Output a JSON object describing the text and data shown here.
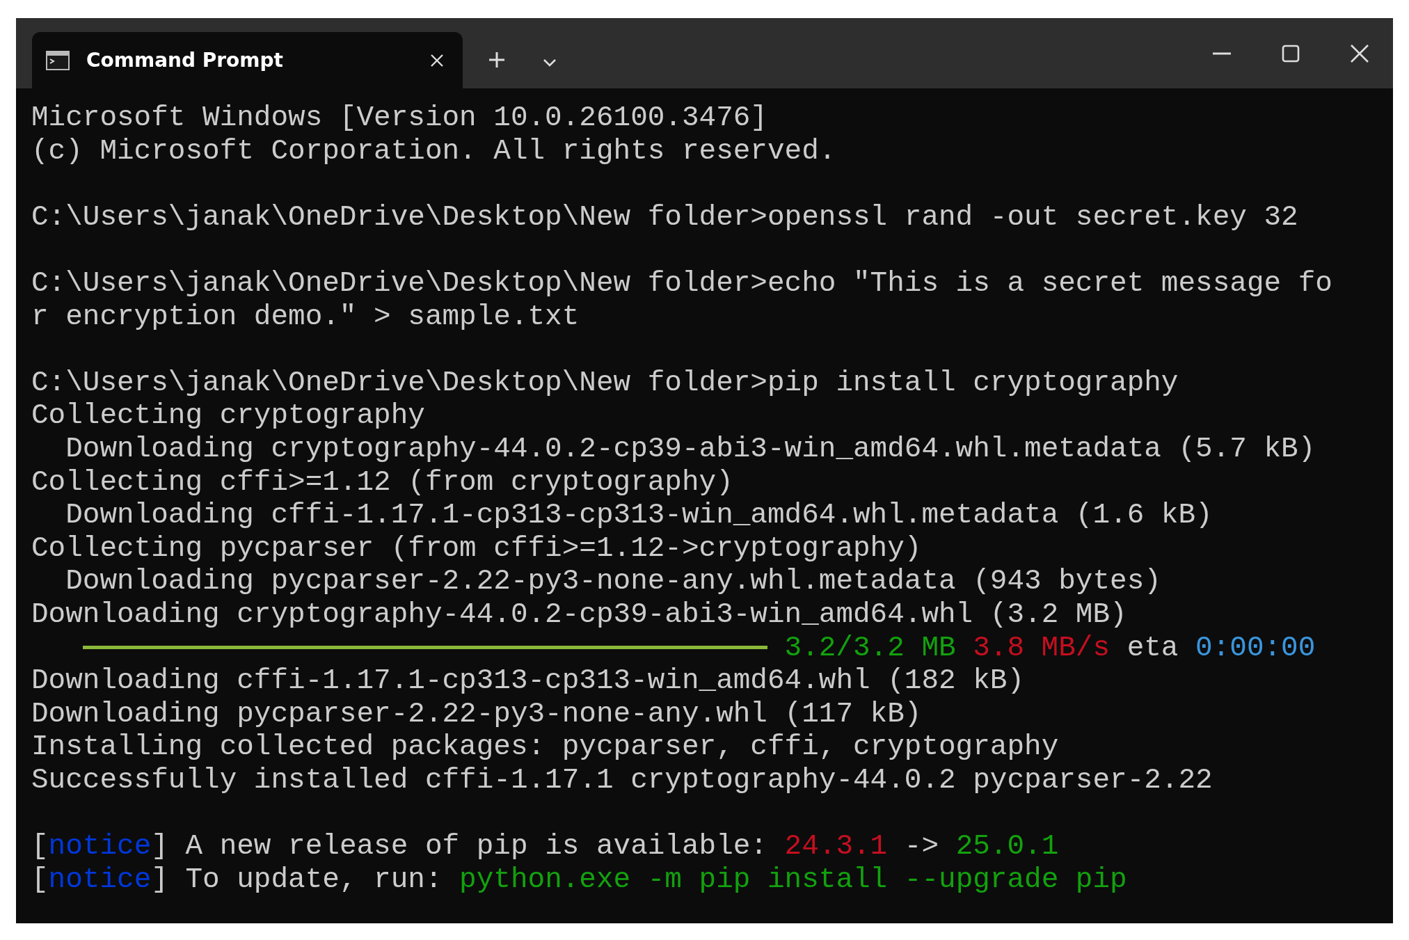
{
  "window": {
    "tabs": [
      {
        "title": "Command Prompt",
        "selected": true
      }
    ]
  },
  "lines": [
    {
      "kind": "text",
      "segments": [
        {
          "text": "Microsoft Windows [Version 10.0.26100.3476]"
        }
      ]
    },
    {
      "kind": "text",
      "segments": [
        {
          "text": "(c) Microsoft Corporation. All rights reserved."
        }
      ]
    },
    {
      "kind": "blank"
    },
    {
      "kind": "text",
      "segments": [
        {
          "text": "C:\\Users\\janak\\OneDrive\\Desktop\\New folder>openssl rand -out secret.key 32"
        }
      ]
    },
    {
      "kind": "blank"
    },
    {
      "kind": "text",
      "segments": [
        {
          "text": "C:\\Users\\janak\\OneDrive\\Desktop\\New folder>echo \"This is a secret message fo"
        }
      ]
    },
    {
      "kind": "text",
      "segments": [
        {
          "text": "r encryption demo.\" > sample.txt"
        }
      ]
    },
    {
      "kind": "blank"
    },
    {
      "kind": "text",
      "segments": [
        {
          "text": "C:\\Users\\janak\\OneDrive\\Desktop\\New folder>pip install cryptography"
        }
      ]
    },
    {
      "kind": "text",
      "segments": [
        {
          "text": "Collecting cryptography"
        }
      ]
    },
    {
      "kind": "text",
      "segments": [
        {
          "text": "  Downloading cryptography-44.0.2-cp39-abi3-win_amd64.whl.metadata (5.7 kB)"
        }
      ]
    },
    {
      "kind": "text",
      "segments": [
        {
          "text": "Collecting cffi>=1.12 (from cryptography)"
        }
      ]
    },
    {
      "kind": "text",
      "segments": [
        {
          "text": "  Downloading cffi-1.17.1-cp313-cp313-win_amd64.whl.metadata (1.6 kB)"
        }
      ]
    },
    {
      "kind": "text",
      "segments": [
        {
          "text": "Collecting pycparser (from cffi>=1.12->cryptography)"
        }
      ]
    },
    {
      "kind": "text",
      "segments": [
        {
          "text": "  Downloading pycparser-2.22-py3-none-any.whl.metadata (943 bytes)"
        }
      ]
    },
    {
      "kind": "text",
      "segments": [
        {
          "text": "Downloading cryptography-44.0.2-cp39-abi3-win_amd64.whl (3.2 MB)"
        }
      ]
    },
    {
      "kind": "progress",
      "level": 1,
      "segments": [
        {
          "text": "3.2/3.2 MB",
          "color": "#13a10e"
        },
        {
          "text": "3.8 MB/s",
          "color": "#c50f1f"
        },
        {
          "text": "eta"
        },
        {
          "text": "0:00:00",
          "color": "#3a96dd"
        }
      ]
    },
    {
      "kind": "text",
      "segments": [
        {
          "text": "Downloading cffi-1.17.1-cp313-cp313-win_amd64.whl (182 kB)"
        }
      ]
    },
    {
      "kind": "text",
      "segments": [
        {
          "text": "Downloading pycparser-2.22-py3-none-any.whl (117 kB)"
        }
      ]
    },
    {
      "kind": "text",
      "segments": [
        {
          "text": "Installing collected packages: pycparser, cffi, cryptography"
        }
      ]
    },
    {
      "kind": "text",
      "segments": [
        {
          "text": "Successfully installed cffi-1.17.1 cryptography-44.0.2 pycparser-2.22"
        }
      ]
    },
    {
      "kind": "blank"
    },
    {
      "kind": "text",
      "segments": [
        {
          "text": "["
        },
        {
          "text": "notice",
          "color": "#0037da"
        },
        {
          "text": "] A new release of pip is available: "
        },
        {
          "text": "24.3.1",
          "color": "#c50f1f"
        },
        {
          "text": " -> "
        },
        {
          "text": "25.0.1",
          "color": "#13a10e"
        }
      ]
    },
    {
      "kind": "text",
      "segments": [
        {
          "text": "["
        },
        {
          "text": "notice",
          "color": "#0037da"
        },
        {
          "text": "] To update, run: "
        },
        {
          "text": "python.exe -m pip install --upgrade pip",
          "color": "#13a10e"
        }
      ]
    }
  ]
}
